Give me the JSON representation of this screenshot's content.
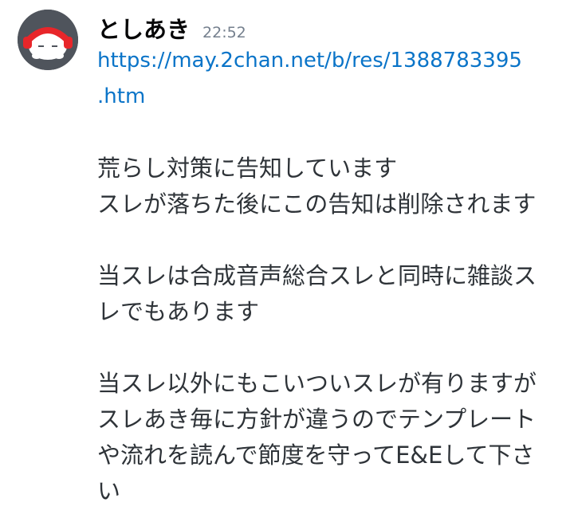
{
  "author": {
    "name": "としあき",
    "avatar_icon": "red-headphones-character-icon"
  },
  "message": {
    "timestamp": "22:52",
    "link_lines": [
      "https://may.2chan.net/b/res/1388783395",
      ".htm"
    ],
    "paragraphs": [
      [
        "荒らし対策に告知しています",
        "スレが落ちた後にこの告知は削除されます"
      ],
      [
        "当スレは合成音声総合スレと同時に雑談ス",
        "レでもあります"
      ],
      [
        "当スレ以外にもこいついスレが有りますが",
        "スレあき毎に方針が違うのでテンプレート",
        "や流れを読んで節度を守ってE&Eして下さ",
        "い"
      ]
    ]
  },
  "colors": {
    "link": "#0a74c8",
    "avatar_bg": "#4f545c",
    "accent_red": "#e8262a"
  }
}
